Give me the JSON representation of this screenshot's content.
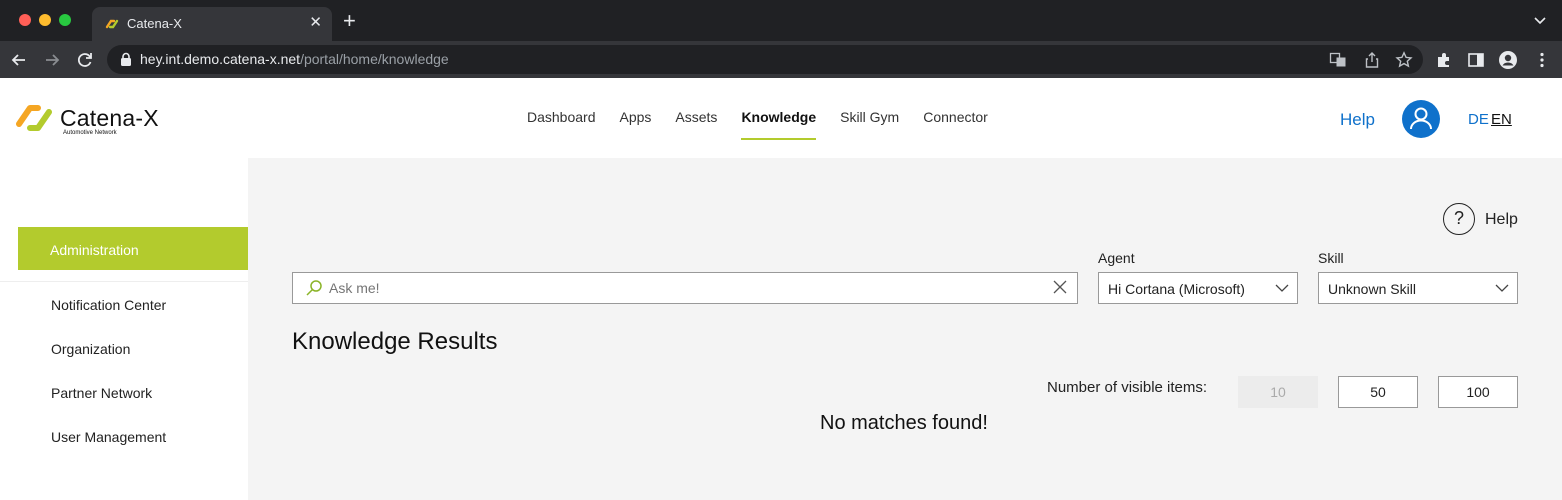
{
  "browser": {
    "tab_title": "Catena-X",
    "new_tab_symbol": "+",
    "close_symbol": "✕",
    "url_host": "hey.int.demo.catena-x.net",
    "url_path": "/portal/home/knowledge"
  },
  "header": {
    "logo_text": "Catena-X",
    "logo_subtitle": "Automotive Network",
    "nav": [
      {
        "label": "Dashboard",
        "active": false
      },
      {
        "label": "Apps",
        "active": false
      },
      {
        "label": "Assets",
        "active": false
      },
      {
        "label": "Knowledge",
        "active": true
      },
      {
        "label": "Skill Gym",
        "active": false
      },
      {
        "label": "Connector",
        "active": false
      }
    ],
    "help": "Help",
    "lang_de": "DE",
    "lang_en": "EN"
  },
  "sidebar": {
    "active_item": "Administration",
    "items": [
      {
        "label": "Notification Center"
      },
      {
        "label": "Organization"
      },
      {
        "label": "Partner Network"
      },
      {
        "label": "User Management"
      }
    ]
  },
  "main": {
    "help_symbol": "?",
    "help_label": "Help",
    "search": {
      "placeholder": "Ask me!",
      "value": ""
    },
    "agent": {
      "label": "Agent",
      "value": "Hi Cortana (Microsoft)"
    },
    "skill": {
      "label": "Skill",
      "value": "Unknown Skill"
    },
    "results_title": "Knowledge Results",
    "visible_items_label": "Number of visible items:",
    "page_sizes": [
      {
        "label": "10",
        "selected": true
      },
      {
        "label": "50",
        "selected": false
      },
      {
        "label": "100",
        "selected": false
      }
    ],
    "empty_message": "No matches found!"
  },
  "colors": {
    "accent_green": "#b3cb2d",
    "link_blue": "#0f71cb",
    "logo_orange": "#f5a623",
    "logo_green": "#b3cb2d"
  }
}
